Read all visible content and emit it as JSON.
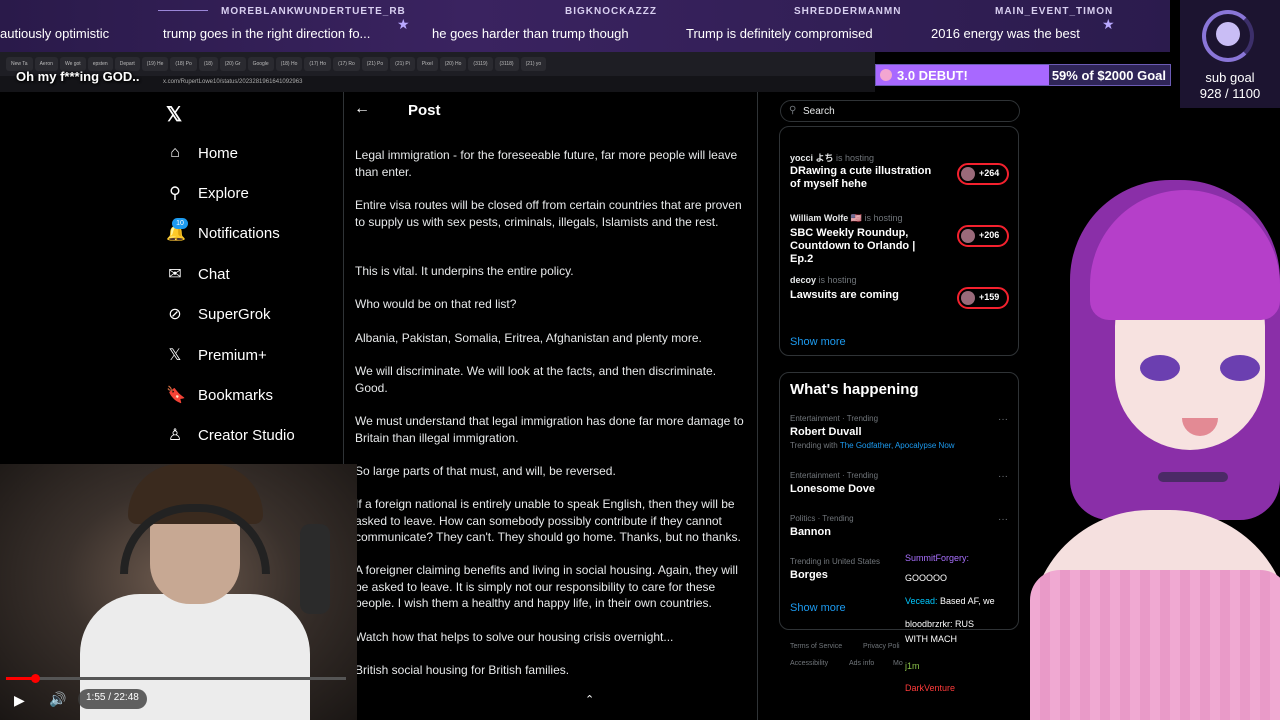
{
  "ticker": [
    {
      "user": "",
      "msg": "autiously optimistic"
    },
    {
      "user": "MOREBLANK",
      "msg": "trump goes in the right direction fo..."
    },
    {
      "user": "WUNDERTUETE_RB",
      "msg": "he goes harder than trump though"
    },
    {
      "user": "BIGKNOCKAZZZ",
      "msg": "Trump is definitely compromised"
    },
    {
      "user": "SHREDDERMANMN",
      "msg": "2016 energy was the best"
    },
    {
      "user": "MAIN_EVENT_TIMON",
      "msg": ""
    }
  ],
  "alert": "Oh my f***ing GOD..",
  "browser": {
    "tabs": [
      "New Ta",
      "Aeron",
      "We got",
      "epsten",
      "Depart",
      "(19) He",
      "(18) Po",
      "(18)",
      "(20) Gr",
      "Google",
      "(18) Ho",
      "(17) Ho",
      "(17) Ro",
      "(21) Po",
      "(21) Pi",
      "Pixel",
      "(20) Ho",
      "(3119)",
      "(3118)",
      "(21) yo"
    ],
    "url": "x.com/RupertLowe10/status/2023281961641092963"
  },
  "goal": {
    "label": "3.0 DEBUT!",
    "amount": "59% of $2000 Goal",
    "progress": 0.59,
    "accent": "#a868ff"
  },
  "subgoal": {
    "title": "sub goal",
    "count": "928 / 1100"
  },
  "x": {
    "nav": [
      {
        "icon": "house-icon",
        "label": "Home"
      },
      {
        "icon": "search-icon",
        "label": "Explore"
      },
      {
        "icon": "bell-icon",
        "label": "Notifications",
        "badge": "10"
      },
      {
        "icon": "mail-icon",
        "label": "Chat"
      },
      {
        "icon": "grok-icon",
        "label": "SuperGrok"
      },
      {
        "icon": "x-icon",
        "label": "Premium+"
      },
      {
        "icon": "bookmark-icon",
        "label": "Bookmarks"
      },
      {
        "icon": "creator-icon",
        "label": "Creator Studio"
      }
    ],
    "post_title": "Post",
    "paragraphs": [
      "Legal immigration - for the foreseeable future, far more people will leave than enter.",
      "Entire visa routes will be closed off from certain countries that are proven to supply us with sex pests, criminals, illegals, Islamists and the rest.",
      "This is vital. It underpins the entire policy.",
      "Who would be on that red list?",
      "Albania, Pakistan, Somalia, Eritrea, Afghanistan and plenty more.",
      "We will discriminate. We will look at the facts, and then discriminate. Good.",
      "We must understand that legal immigration has done far more damage to Britain than illegal immigration.",
      "So large parts of that must, and will, be reversed.",
      "If a foreign national is entirely unable to speak English, then they will be asked to leave. How can somebody possibly contribute if they cannot communicate? They can't. They should go home. Thanks, but no thanks.",
      "A foreigner claiming benefits and living in social housing. Again, they will be asked to leave. It is simply not our responsibility to care for these people. I wish them a healthy and happy life, in their own countries.",
      "Watch how that helps to solve our housing crisis overnight...",
      "British social housing for British families."
    ],
    "search_placeholder": "Search",
    "hosts": [
      {
        "name": "yocci よち",
        "status": "is hosting",
        "title": "DRawing a cute illustration of myself hehe",
        "count": "+264"
      },
      {
        "name": "William Wolfe 🇺🇸",
        "status": "is hosting",
        "title": "SBC Weekly Roundup, Countdown to Orlando | Ep.2",
        "count": "+206"
      },
      {
        "name": "decoy",
        "status": "is hosting",
        "title": "Lawsuits are coming",
        "count": "+159"
      }
    ],
    "show_more": "Show more",
    "happening_title": "What's happening",
    "trends": [
      {
        "category": "Entertainment · Trending",
        "title": "Robert Duvall",
        "sub_prefix": "Trending with ",
        "sub_link": "The Godfather, Apocalypse Now"
      },
      {
        "category": "Entertainment · Trending",
        "title": "Lonesome Dove",
        "sub_prefix": "",
        "sub_link": ""
      },
      {
        "category": "Politics · Trending",
        "title": "Bannon",
        "sub_prefix": "",
        "sub_link": ""
      },
      {
        "category": "Trending in United States",
        "title": "Borges",
        "sub_prefix": "",
        "sub_link": ""
      }
    ],
    "footer": [
      "Terms of Service",
      "Privacy Poli",
      "Accessibility",
      "Ads info",
      "Mo"
    ]
  },
  "chat": [
    {
      "user": "SummitForgery:",
      "msg": "",
      "color": "#a970ff"
    },
    {
      "user": "",
      "msg": "GOOOOO",
      "color": "#ffffff"
    },
    {
      "user": "Vecead:",
      "msg": "Based AF, we",
      "color": "#00c8ff"
    },
    {
      "user": "bloodbrzrkr:",
      "msg": "RUS",
      "color": "#ffffff"
    },
    {
      "user": "",
      "msg": "WITH MACH",
      "color": "#ffffff"
    },
    {
      "user": "",
      "msg": "j1m",
      "color": "#8bc34a"
    },
    {
      "user": "DarkVenture",
      "msg": "",
      "color": "#ff3b3b"
    }
  ],
  "player": {
    "time": "1:55 / 22:48",
    "progress": 0.0846
  }
}
